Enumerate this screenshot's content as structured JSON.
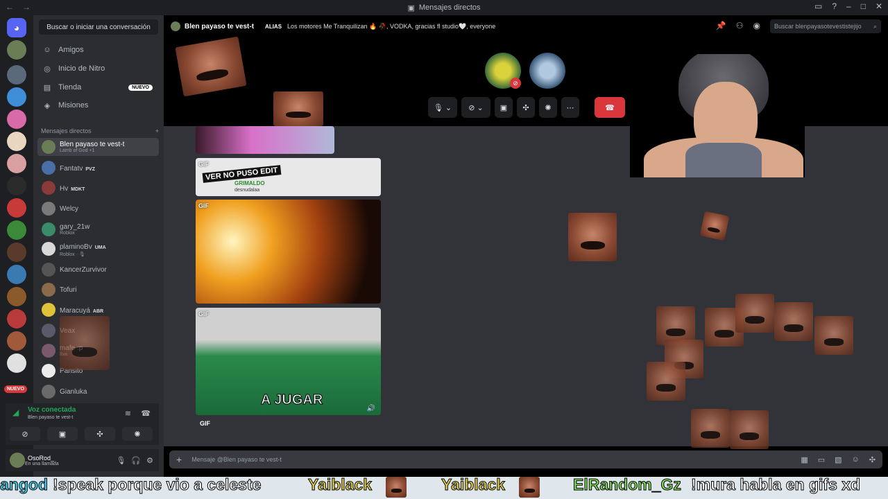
{
  "window": {
    "title": "Mensajes directos"
  },
  "sidebar": {
    "search_label": "Buscar o iniciar una conversación",
    "nav": [
      {
        "label": "Amigos",
        "icon": "friends-icon"
      },
      {
        "label": "Inicio de Nitro",
        "icon": "nitro-icon"
      },
      {
        "label": "Tienda",
        "icon": "shop-icon",
        "badge": "NUEVO"
      },
      {
        "label": "Misiones",
        "icon": "quests-icon"
      }
    ],
    "dm_header": "Mensajes directos",
    "dm_add": "+",
    "dms": [
      {
        "name": "Blen payaso te vest-t",
        "sub": "Lamb of God +1",
        "active": true,
        "color": "#6b7d55"
      },
      {
        "name": "Fantatv",
        "tag": "PVZ",
        "color": "#4a6fa5"
      },
      {
        "name": "Hv",
        "tag": "MDKT",
        "color": "#8b3a3a"
      },
      {
        "name": "Welcy",
        "color": "#7a7a7a"
      },
      {
        "name": "gary_21w",
        "sub": "Roblox",
        "color": "#3a8b6a"
      },
      {
        "name": "plaminoBv",
        "tag": "UMA",
        "sub": "Roblox · 🎙",
        "color": "#d9d9d9"
      },
      {
        "name": "KancerZurvivor",
        "color": "#555555"
      },
      {
        "name": "Tofuri",
        "color": "#8a6a4a"
      },
      {
        "name": "Maracuyá",
        "tag": "ABR",
        "color": "#e0c23a"
      },
      {
        "name": "Veax",
        "color": "#5a5a6a"
      },
      {
        "name": "mafe :p",
        "sub": "Ibai",
        "color": "#7a5a6a"
      },
      {
        "name": "Pansito",
        "color": "#ececec"
      },
      {
        "name": "Gianluka",
        "color": "#6a6a6a"
      }
    ],
    "new_badge": "NUEVO",
    "voice": {
      "status": "Voz conectada",
      "channel": "Blen payaso te vest-t"
    },
    "user": {
      "name": "OsoRod_",
      "status": "En una llamada"
    }
  },
  "channel": {
    "name": "Blen payaso te vest-t",
    "alias_label": "ALIAS",
    "alias_text": "Los motores Me Tranquilizan 🔥 🥀, VODKA, gracias fl studio🤍, everyone",
    "search_placeholder": "Buscar blenpayasotevestistejijo"
  },
  "messages": {
    "gif_label": "GIF",
    "gif_caption": "A JUGAR",
    "embed_text": "VER NO PUSO EDIT",
    "embed_user": "GRIMALDO",
    "embed_sub": "desnudalaa"
  },
  "composer": {
    "placeholder": "Mensaje @Blen payaso te vest-t"
  },
  "ticker": [
    {
      "text": "angod",
      "color": "cyan"
    },
    {
      "text": "!speak porque vio a celeste",
      "color": "white"
    },
    {
      "text": "Yaiblack",
      "color": "yellow"
    },
    {
      "text": "Yaiblack",
      "color": "yellow"
    },
    {
      "text": "ElRandom_Gz",
      "color": "green"
    },
    {
      "text": "!mura habla en gifs xd",
      "color": "white"
    }
  ],
  "colors": {
    "accent": "#5865f2",
    "green": "#23a55a",
    "red": "#da373c",
    "bg": "#313338"
  }
}
